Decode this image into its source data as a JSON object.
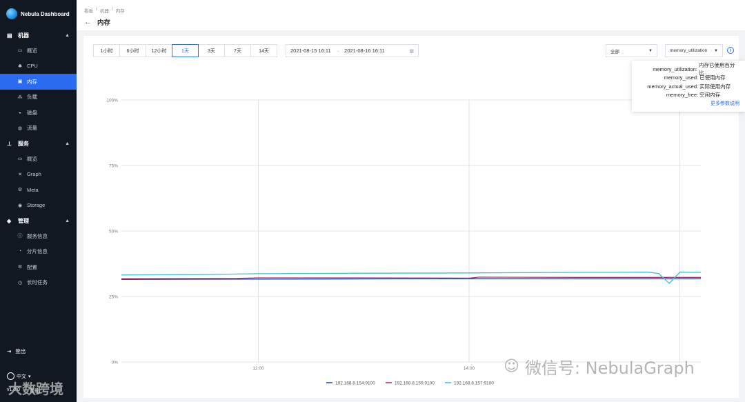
{
  "app": {
    "title": "Nebula Dashboard"
  },
  "sidebar": {
    "groups": [
      {
        "label": "机器",
        "items": [
          {
            "label": "概览",
            "icon": "overview-icon"
          },
          {
            "label": "CPU",
            "icon": "cpu-icon"
          },
          {
            "label": "内存",
            "icon": "memory-icon",
            "active": true
          },
          {
            "label": "负载",
            "icon": "load-icon"
          },
          {
            "label": "磁盘",
            "icon": "disk-icon"
          },
          {
            "label": "流量",
            "icon": "traffic-icon"
          }
        ]
      },
      {
        "label": "服务",
        "items": [
          {
            "label": "概览",
            "icon": "overview-icon"
          },
          {
            "label": "Graph",
            "icon": "graph-icon"
          },
          {
            "label": "Meta",
            "icon": "meta-icon"
          },
          {
            "label": "Storage",
            "icon": "storage-icon"
          }
        ]
      },
      {
        "label": "管理",
        "items": [
          {
            "label": "服务信息",
            "icon": "info-icon"
          },
          {
            "label": "分片信息",
            "icon": "partition-icon"
          },
          {
            "label": "配置",
            "icon": "config-icon"
          },
          {
            "label": "长时任务",
            "icon": "task-icon"
          }
        ]
      }
    ],
    "logout": "登出",
    "language": "中文",
    "version": "v1.0.0",
    "help": "帮助"
  },
  "header": {
    "breadcrumb": [
      "看板",
      "机器",
      "内存"
    ],
    "title": "内存"
  },
  "toolbar": {
    "ranges": [
      "1小时",
      "6小时",
      "12小时",
      "1天",
      "3天",
      "7天",
      "14天"
    ],
    "active_range": "1天",
    "start": "2021-08-15 16:11",
    "end": "2021-08-16 16:11",
    "instance_select": "全部",
    "metric_select": "memory_utilization"
  },
  "tooltip": {
    "rows": [
      {
        "key": "memory_utilization",
        "value": "内存已使用百分比"
      },
      {
        "key": "memory_used",
        "value": "已使用内存"
      },
      {
        "key": "memory_actual_used",
        "value": "实际使用内存"
      },
      {
        "key": "memory_free",
        "value": "空闲内存"
      }
    ],
    "more": "更多参数说明"
  },
  "colors": {
    "accent": "#2a6bf0",
    "sidebar_bg": "#121822"
  },
  "chart_data": {
    "type": "line",
    "y_ticks": [
      "100%",
      "75%",
      "50%",
      "25%",
      "0%"
    ],
    "ylim": [
      0,
      100
    ],
    "x_ticks": [
      "12:00",
      "14:00"
    ],
    "x_hours": [
      10.7,
      16.2
    ],
    "x_tick_hours": [
      12,
      14,
      16
    ],
    "series": [
      {
        "name": "192.168.8.154:9100",
        "color": "#1f49a8",
        "x": [
          10.7,
          12,
          13,
          14,
          15,
          15.8,
          16.2
        ],
        "values": [
          31.5,
          31.6,
          31.7,
          31.8,
          31.8,
          31.8,
          31.8
        ]
      },
      {
        "name": "192.168.8.155:9100",
        "color": "#a8306a",
        "x": [
          10.7,
          11.8,
          12,
          13,
          14,
          14.1,
          15,
          15.8,
          16.2
        ],
        "values": [
          31.8,
          31.9,
          32.1,
          32.1,
          32.0,
          32.4,
          32.3,
          32.3,
          32.3
        ]
      },
      {
        "name": "192.168.8.157:9100",
        "color": "#3cc0d8",
        "x": [
          10.7,
          11.5,
          12,
          13,
          14,
          15,
          15.7,
          15.8,
          15.9,
          16.0,
          16.2
        ],
        "values": [
          33.2,
          33.4,
          33.7,
          33.9,
          34.0,
          34.2,
          34.3,
          33.8,
          30.0,
          34.3,
          34.2
        ]
      }
    ]
  },
  "watermark": {
    "text": "微信号: NebulaGraph",
    "overlay": "大数跨境"
  }
}
